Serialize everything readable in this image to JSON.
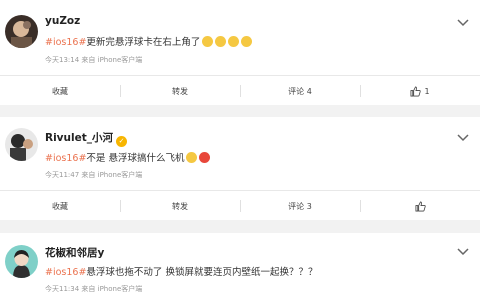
{
  "posts": [
    {
      "username": "yuZoz",
      "tag": "#ios16#",
      "text": "更新完悬浮球卡在右上角了",
      "emojis": [
        "laughing-crying-emoji",
        "laughing-crying-emoji",
        "laughing-crying-emoji",
        "laughing-crying-emoji"
      ],
      "meta": "今天13:14  来自 iPhone客户端",
      "actions": {
        "collect": "收藏",
        "repost": "转发",
        "comment": "评论 4",
        "like": "1"
      }
    },
    {
      "username": "Rivulet_小河",
      "verified": true,
      "tag": "#ios16#",
      "text": "不是 悬浮球搞什么飞机",
      "emojis": [
        "thinking-emoji",
        "angry-emoji"
      ],
      "meta": "今天11:47  来自 iPhone客户端",
      "actions": {
        "collect": "收藏",
        "repost": "转发",
        "comment": "评论 3",
        "like": ""
      }
    },
    {
      "username": "花椒和邻居y",
      "tag": "#ios16#",
      "text": "悬浮球也拖不动了 换锁屏就要连页内壁纸一起换？？？",
      "meta": "今天11:34  来自 iPhone客户端"
    }
  ],
  "colors": {
    "tag": "#eb7350",
    "background": "#f2f2f2"
  }
}
